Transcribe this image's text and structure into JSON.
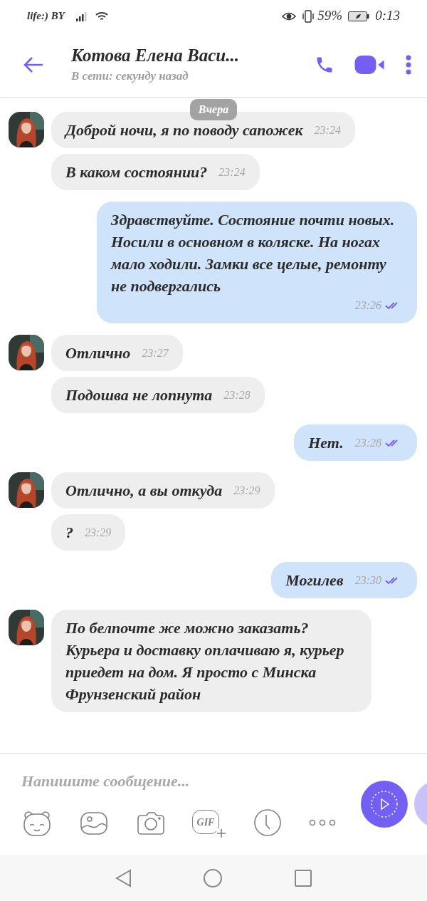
{
  "status_bar": {
    "carrier": "life:) BY",
    "battery": "59%",
    "time": "0:13"
  },
  "header": {
    "name": "Котова Елена Васи...",
    "status": "В сети: секунду назад"
  },
  "date_label": "Вчера",
  "messages": [
    {
      "kind": "incoming",
      "show_avatar": true,
      "text": "Доброй ночи, я по поводу сапожек",
      "time": "23:24"
    },
    {
      "kind": "incoming",
      "show_avatar": false,
      "text": "В каком состоянии?",
      "time": "23:24"
    },
    {
      "kind": "outgoing",
      "read": true,
      "text": "Здравствуйте. Состояние почти новых. Носили в основном в коляске. На ногах мало ходили. Замки все целые, ремонту не подвергались",
      "time": "23:26"
    },
    {
      "kind": "incoming",
      "show_avatar": true,
      "text": "Отлично",
      "time": "23:27"
    },
    {
      "kind": "incoming",
      "show_avatar": false,
      "text": "Подошва не лопнута",
      "time": "23:28"
    },
    {
      "kind": "outgoing",
      "read": true,
      "text": "Нет.",
      "time": "23:28"
    },
    {
      "kind": "incoming",
      "show_avatar": true,
      "text": "Отлично, а вы откуда",
      "time": "23:29"
    },
    {
      "kind": "incoming",
      "show_avatar": false,
      "text": "?",
      "time": "23:29"
    },
    {
      "kind": "outgoing",
      "read": true,
      "text": "Могилев",
      "time": "23:30"
    },
    {
      "kind": "incoming",
      "show_avatar": true,
      "text": "По белпочте же можно заказать? Курьера и доставку оплачиваю я, курьер приедет на дом. Я просто с Минска Фрунзенский район"
    }
  ],
  "composer": {
    "placeholder": "Напишите сообщение..."
  },
  "toolbar": [
    {
      "kind": "sticker"
    },
    {
      "kind": "gallery"
    },
    {
      "kind": "camera"
    },
    {
      "kind": "gif",
      "label": "GIF"
    },
    {
      "kind": "timer"
    },
    {
      "kind": "more"
    }
  ]
}
